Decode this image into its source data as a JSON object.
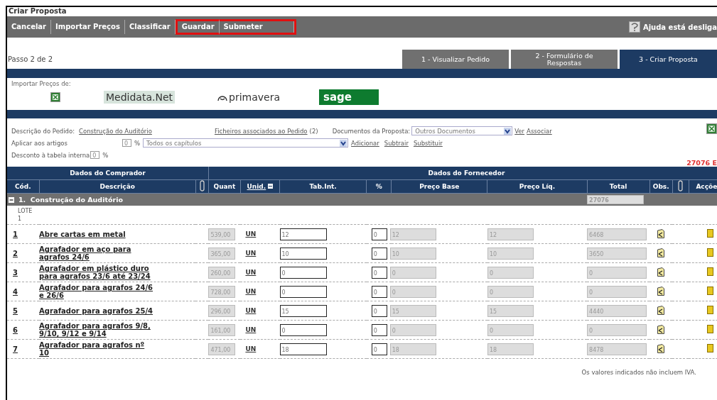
{
  "window": {
    "title": "Criar Proposta"
  },
  "toolbar": {
    "buttons": [
      {
        "label": "Cancelar",
        "highlighted": false
      },
      {
        "label": "Importar Preços",
        "highlighted": false
      },
      {
        "label": "Classificar",
        "highlighted": false
      },
      {
        "label": "Guardar",
        "highlighted": true
      },
      {
        "label": "Submeter",
        "highlighted": true
      }
    ],
    "help": "Ajuda está desliga"
  },
  "step_label": "Passo 2 de 2",
  "steps": [
    {
      "label": "1 - Visualizar Pedido",
      "selected": false
    },
    {
      "label": "2 - Formulário de Respostas",
      "selected": false
    },
    {
      "label": "3 - Criar Proposta",
      "selected": true
    }
  ],
  "import": {
    "label": "Importar Preços de:",
    "sources": [
      {
        "kind": "excel"
      },
      {
        "kind": "medidata",
        "text": "Medidata.Net"
      },
      {
        "kind": "primavera",
        "text": "primavera"
      },
      {
        "kind": "sage",
        "text": "sage"
      }
    ]
  },
  "form": {
    "description_label": "Descrição do Pedido:",
    "description": "Construção do Auditório",
    "files_link": "Ficheiros associados ao Pedido",
    "files_count": "(2)",
    "documents_label": "Documentos da Proposta:",
    "documents_select": "Outros Documentos",
    "view_link": "Ver",
    "associate_link": "Associar",
    "apply_label": "Aplicar aos artigos",
    "apply_value": "0",
    "apply_percent": "%",
    "chapters_select": "Todos os capítulos",
    "actions": [
      "Adicionar",
      "Subtrair",
      "Substituir"
    ],
    "discount_label": "Desconto à tabela interna",
    "discount_value": "0",
    "discount_percent": "%",
    "total": "27076 E"
  },
  "table": {
    "groups": [
      "Dados do Comprador",
      "Dados do Fornecedor"
    ],
    "columns": [
      {
        "kind": "text",
        "label": "Cód."
      },
      {
        "kind": "text",
        "label": "Descrição"
      },
      {
        "kind": "clip"
      },
      {
        "kind": "text",
        "label": "Quant"
      },
      {
        "kind": "sort",
        "label": "Unid."
      },
      {
        "kind": "text",
        "label": "Tab.Int."
      },
      {
        "kind": "text",
        "label": "%"
      },
      {
        "kind": "text",
        "label": "Preço Base"
      },
      {
        "kind": "text",
        "label": "Preço Líq."
      },
      {
        "kind": "text",
        "label": "Total"
      },
      {
        "kind": "text",
        "label": "Obs."
      },
      {
        "kind": "clip"
      },
      {
        "kind": "text",
        "label": "Acçõe"
      }
    ],
    "section": {
      "label": "1.  Construção do Auditório",
      "expanded": true,
      "total": "27076"
    },
    "lot": "LOTE 1",
    "rows": [
      {
        "code": "1",
        "description": "Abre cartas em metal",
        "quantity": "539,00",
        "unit": "UN",
        "tab_int": "12",
        "percent": "0",
        "base_price": "12",
        "net_price": "12",
        "total": "6468"
      },
      {
        "code": "2",
        "description": "Agrafador em aço para agrafos 24/6",
        "quantity": "365,00",
        "unit": "UN",
        "tab_int": "10",
        "percent": "0",
        "base_price": "10",
        "net_price": "10",
        "total": "3650"
      },
      {
        "code": "3",
        "description": "Agrafador em plástico duro para agrafos 23/6 até 23/24",
        "quantity": "260,00",
        "unit": "UN",
        "tab_int": "0",
        "percent": "0",
        "base_price": "0",
        "net_price": "0",
        "total": "0"
      },
      {
        "code": "4",
        "description": "Agrafador para agrafos 24/6 e 26/6",
        "quantity": "728,00",
        "unit": "UN",
        "tab_int": "0",
        "percent": "0",
        "base_price": "0",
        "net_price": "0",
        "total": "0"
      },
      {
        "code": "5",
        "description": "Agrafador para agrafos 25/4",
        "quantity": "296,00",
        "unit": "UN",
        "tab_int": "15",
        "percent": "0",
        "base_price": "15",
        "net_price": "15",
        "total": "4440"
      },
      {
        "code": "6",
        "description": "Agrafador para agrafos 9/8, 9/10, 9/12 e 9/14",
        "quantity": "161,00",
        "unit": "UN",
        "tab_int": "0",
        "percent": "0",
        "base_price": "0",
        "net_price": "0",
        "total": "0"
      },
      {
        "code": "7",
        "description": "Agrafador para agrafos nº 10",
        "quantity": "471,00",
        "unit": "UN",
        "tab_int": "18",
        "percent": "0",
        "base_price": "18",
        "net_price": "18",
        "total": "8478"
      }
    ]
  },
  "footer": "Os valores indicados não incluem IVA."
}
